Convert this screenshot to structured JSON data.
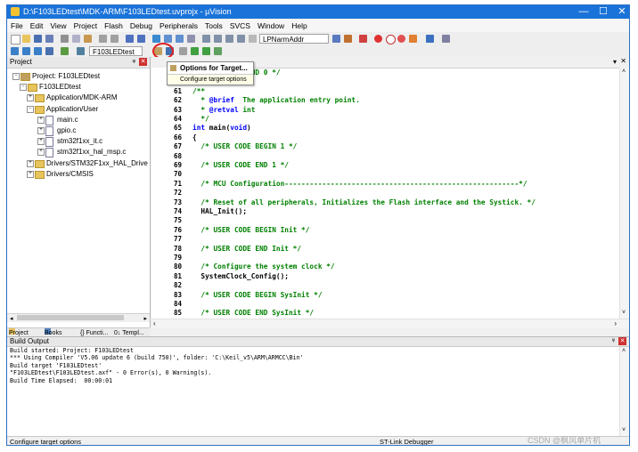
{
  "window": {
    "title": "D:\\F103LEDtest\\MDK-ARM\\F103LEDtest.uvprojx - µVision",
    "minimize": "—",
    "maximize": "☐",
    "close": "✕"
  },
  "menu": [
    "File",
    "Edit",
    "View",
    "Project",
    "Flash",
    "Debug",
    "Peripherals",
    "Tools",
    "SVCS",
    "Window",
    "Help"
  ],
  "toolbar": {
    "find_combo": "LPNarmAddr",
    "target_combo": "F103LEDtest"
  },
  "popup": {
    "item": "Options for Target...",
    "tooltip": "Configure target options"
  },
  "project_panel": {
    "title": "Project",
    "pin": "ᵠ",
    "close": "✕",
    "items": [
      {
        "label": "Project: F103LEDtest"
      },
      {
        "label": "F103LEDtest"
      },
      {
        "label": "Application/MDK-ARM"
      },
      {
        "label": "Application/User"
      },
      {
        "label": "main.c"
      },
      {
        "label": "gpio.c"
      },
      {
        "label": "stm32f1xx_it.c"
      },
      {
        "label": "stm32f1xx_hal_msp.c"
      },
      {
        "label": "Drivers/STM32F1xx_HAL_Drive"
      },
      {
        "label": "Drivers/CMSIS"
      }
    ],
    "tabs": [
      "Project",
      "Books",
      "{} Functi...",
      "0↓ Templ..."
    ]
  },
  "editor": {
    "lines": [
      {
        "n": "59",
        "text": "/* USER CODE END 0 */",
        "cls": "cm",
        "indent": 0
      },
      {
        "n": "60",
        "text": "",
        "cls": "",
        "indent": 0
      },
      {
        "n": "61",
        "text": "/**",
        "cls": "cm",
        "indent": 0
      },
      {
        "n": "62",
        "text": "  * @brief  The application entry point.",
        "cls": "cm",
        "indent": 0
      },
      {
        "n": "63",
        "text": "  * @retval int",
        "cls": "cm",
        "indent": 0
      },
      {
        "n": "64",
        "text": "  */",
        "cls": "cm",
        "indent": 0
      },
      {
        "n": "65",
        "text": "int main(void)",
        "cls": "mix",
        "indent": 0
      },
      {
        "n": "66",
        "text": "{",
        "cls": "",
        "indent": 0
      },
      {
        "n": "67",
        "text": "  /* USER CODE BEGIN 1 */",
        "cls": "cm",
        "indent": 0
      },
      {
        "n": "68",
        "text": "",
        "cls": "",
        "indent": 0
      },
      {
        "n": "69",
        "text": "  /* USER CODE END 1 */",
        "cls": "cm",
        "indent": 0
      },
      {
        "n": "70",
        "text": "",
        "cls": "",
        "indent": 0
      },
      {
        "n": "71",
        "text": "  /* MCU Configuration--------------------------------------------------------*/",
        "cls": "cm",
        "indent": 0
      },
      {
        "n": "72",
        "text": "",
        "cls": "",
        "indent": 0
      },
      {
        "n": "73",
        "text": "  /* Reset of all peripherals, Initializes the Flash interface and the Systick. */",
        "cls": "cm",
        "indent": 0
      },
      {
        "n": "74",
        "text": "  HAL_Init();",
        "cls": "",
        "indent": 0
      },
      {
        "n": "75",
        "text": "",
        "cls": "",
        "indent": 0
      },
      {
        "n": "76",
        "text": "  /* USER CODE BEGIN Init */",
        "cls": "cm",
        "indent": 0
      },
      {
        "n": "77",
        "text": "",
        "cls": "",
        "indent": 0
      },
      {
        "n": "78",
        "text": "  /* USER CODE END Init */",
        "cls": "cm",
        "indent": 0
      },
      {
        "n": "79",
        "text": "",
        "cls": "",
        "indent": 0
      },
      {
        "n": "80",
        "text": "  /* Configure the system clock */",
        "cls": "cm",
        "indent": 0
      },
      {
        "n": "81",
        "text": "  SystemClock_Config();",
        "cls": "",
        "indent": 0
      },
      {
        "n": "82",
        "text": "",
        "cls": "",
        "indent": 0
      },
      {
        "n": "83",
        "text": "  /* USER CODE BEGIN SysInit */",
        "cls": "cm",
        "indent": 0
      },
      {
        "n": "84",
        "text": "",
        "cls": "",
        "indent": 0
      },
      {
        "n": "85",
        "text": "  /* USER CODE END SysInit */",
        "cls": "cm",
        "indent": 0
      }
    ]
  },
  "build_output": {
    "title": "Build Output",
    "lines": [
      "Build started: Project: F103LEDtest",
      "*** Using Compiler 'V5.06 update 6 (build 750)', folder: 'C:\\Keil_v5\\ARM\\ARMCC\\Bin'",
      "Build target 'F103LEDtest'",
      "\"F103LEDtest\\F103LEDtest.axf\" - 0 Error(s), 0 Warning(s).",
      "Build Time Elapsed:  00:00:01"
    ]
  },
  "status": {
    "left": "Configure target options",
    "debugger": "ST-Link Debugger"
  },
  "watermark": "CSDN @枫风单片机"
}
